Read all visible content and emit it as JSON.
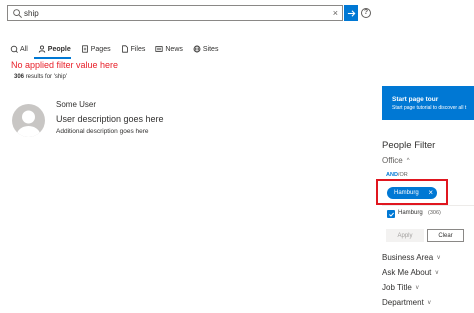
{
  "search": {
    "value": "ship"
  },
  "tabs": [
    {
      "label": "All",
      "icon": "globe-all-icon"
    },
    {
      "label": "People",
      "icon": "people-icon",
      "active": true
    },
    {
      "label": "Pages",
      "icon": "pages-icon"
    },
    {
      "label": "Files",
      "icon": "files-icon"
    },
    {
      "label": "News",
      "icon": "news-icon"
    },
    {
      "label": "Sites",
      "icon": "sites-icon"
    }
  ],
  "annotation": "No applied filter value here",
  "results": {
    "count": "306",
    "text": "results for 'ship'"
  },
  "person": {
    "name": "Some User",
    "description": "User description goes here",
    "additional": "Additional description goes here"
  },
  "tour": {
    "title": "Start page tour",
    "subtitle": "Start page tutorial to discover all t"
  },
  "filter": {
    "title": "People Filter",
    "office_label": "Office",
    "and_label": "AND",
    "or_label": "/OR",
    "chip_label": "Hamburg",
    "option_label": "Hamburg",
    "option_count": "(306)",
    "apply_label": "Apply",
    "clear_label": "Clear",
    "sections": [
      "Business Area",
      "Ask Me About",
      "Job Title",
      "Department"
    ]
  },
  "colors": {
    "accent": "#0078d4",
    "annotation_red": "#e8202a"
  }
}
